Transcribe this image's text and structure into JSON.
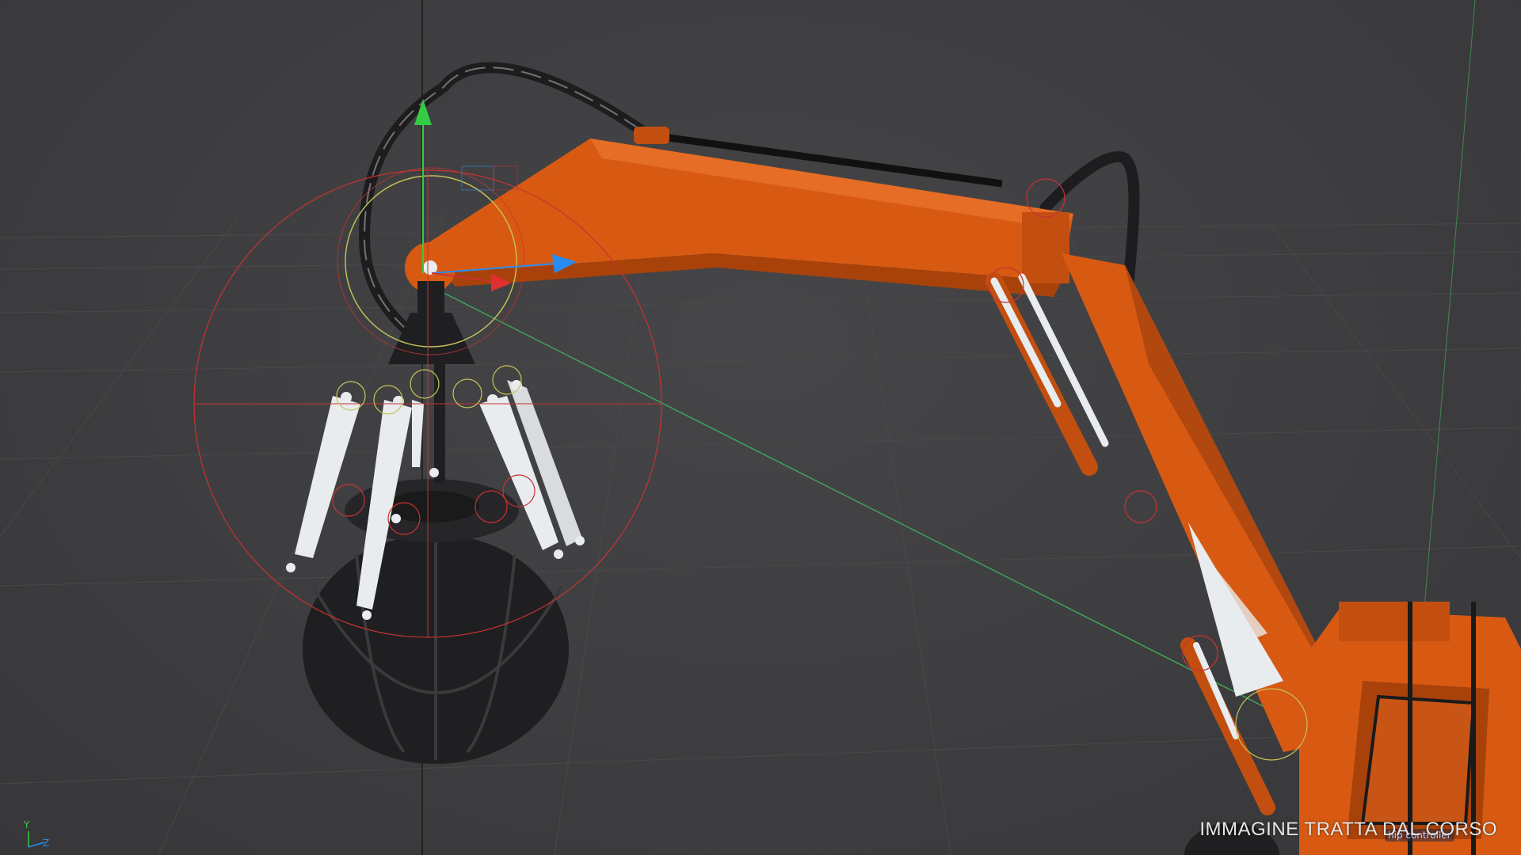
{
  "viewport": {
    "watermark": "IMMAGINE TRATTA DAL CORSO",
    "controller_label": "hip controller",
    "axis_labels": {
      "y": "Y",
      "z": "Z"
    }
  },
  "colors": {
    "background": "#3f3f41",
    "grid": "#4a4a4c",
    "arm_orange": "#d85a12",
    "arm_dark_orange": "#a8420a",
    "grapple_black": "#1f1f21",
    "steel_white": "#e8ecee",
    "gizmo_red": "#c83232",
    "gizmo_yellow": "#c8c35a",
    "gizmo_green": "#33cc44",
    "gizmo_blue": "#2a8cf0",
    "axis_green_line": "#3fa85a"
  }
}
